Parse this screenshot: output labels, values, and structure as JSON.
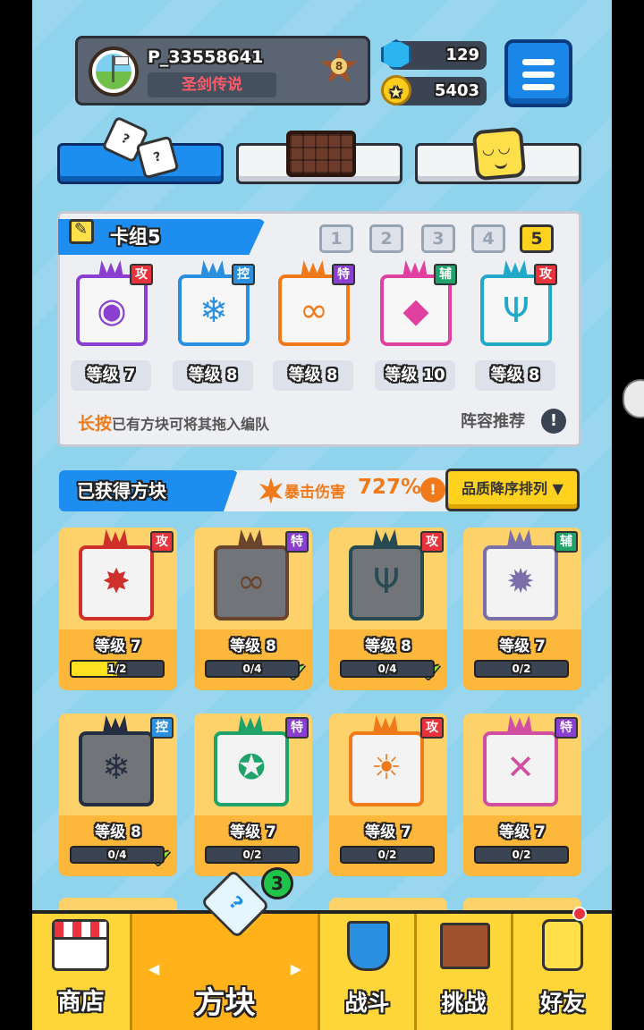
{
  "player": {
    "name": "P_33558641",
    "title": "圣剑传说",
    "rank": "8"
  },
  "resources": {
    "gems": "129",
    "gold": "5403"
  },
  "deck": {
    "title": "卡组5",
    "slots": [
      "1",
      "2",
      "3",
      "4",
      "5"
    ],
    "active_slot": 5,
    "cards": [
      {
        "level": "等级 7",
        "tag": "攻",
        "type": "atk",
        "color": "#8b3fd1",
        "glyph": "◉"
      },
      {
        "level": "等级 8",
        "tag": "控",
        "type": "ctl",
        "color": "#2b8fe0",
        "glyph": "❄"
      },
      {
        "level": "等级 8",
        "tag": "特",
        "type": "spe",
        "color": "#f07a1a",
        "glyph": "∞"
      },
      {
        "level": "等级 10",
        "tag": "辅",
        "type": "sup",
        "color": "#e040a0",
        "glyph": "◆"
      },
      {
        "level": "等级 8",
        "tag": "攻",
        "type": "atk",
        "color": "#22a8c8",
        "glyph": "Ψ"
      }
    ],
    "hint_strong": "长按",
    "hint_text": "已有方块可将其拖入编队",
    "recommend": "阵容推荐"
  },
  "owned": {
    "title": "已获得方块",
    "crit_label": "暴击伤害",
    "crit_value": "727%",
    "sort": "品质降序排列",
    "cards": [
      {
        "level": "等级 7",
        "progress": "1/2",
        "tag": "攻",
        "type": "atk",
        "color": "#d0302c",
        "glyph": "✸",
        "fill": 0.5,
        "check": false,
        "dim": false
      },
      {
        "level": "等级 8",
        "progress": "0/4",
        "tag": "特",
        "type": "spe",
        "color": "#b05a20",
        "glyph": "∞",
        "fill": 0,
        "check": true,
        "dim": true
      },
      {
        "level": "等级 8",
        "progress": "0/4",
        "tag": "攻",
        "type": "atk",
        "color": "#1d6f80",
        "glyph": "Ψ",
        "fill": 0,
        "check": true,
        "dim": true
      },
      {
        "level": "等级 7",
        "progress": "0/2",
        "tag": "辅",
        "type": "sup",
        "color": "#7a6fa8",
        "glyph": "✹",
        "fill": 0,
        "check": false,
        "dim": false
      },
      {
        "level": "等级 8",
        "progress": "0/4",
        "tag": "控",
        "type": "ctl",
        "color": "#2a3f6e",
        "glyph": "❄",
        "fill": 0,
        "check": true,
        "dim": true
      },
      {
        "level": "等级 7",
        "progress": "0/2",
        "tag": "特",
        "type": "spe",
        "color": "#1fa36a",
        "glyph": "✪",
        "fill": 0,
        "check": false,
        "dim": false
      },
      {
        "level": "等级 7",
        "progress": "0/2",
        "tag": "攻",
        "type": "atk",
        "color": "#f07a1a",
        "glyph": "☀",
        "fill": 0,
        "check": false,
        "dim": false
      },
      {
        "level": "等级 7",
        "progress": "0/2",
        "tag": "特",
        "type": "spe",
        "color": "#d04fa0",
        "glyph": "✕",
        "fill": 0,
        "check": false,
        "dim": false
      }
    ]
  },
  "nav": {
    "shop": "商店",
    "block": "方块",
    "battle": "战斗",
    "challenge": "挑战",
    "friends": "好友",
    "block_badge": "3"
  },
  "icons": {
    "menu": "hamburger-menu-icon",
    "gem": "gem-icon",
    "coin": "coin-icon",
    "dice": "dice-icon",
    "board": "board-icon",
    "emote": "emote-icon"
  }
}
